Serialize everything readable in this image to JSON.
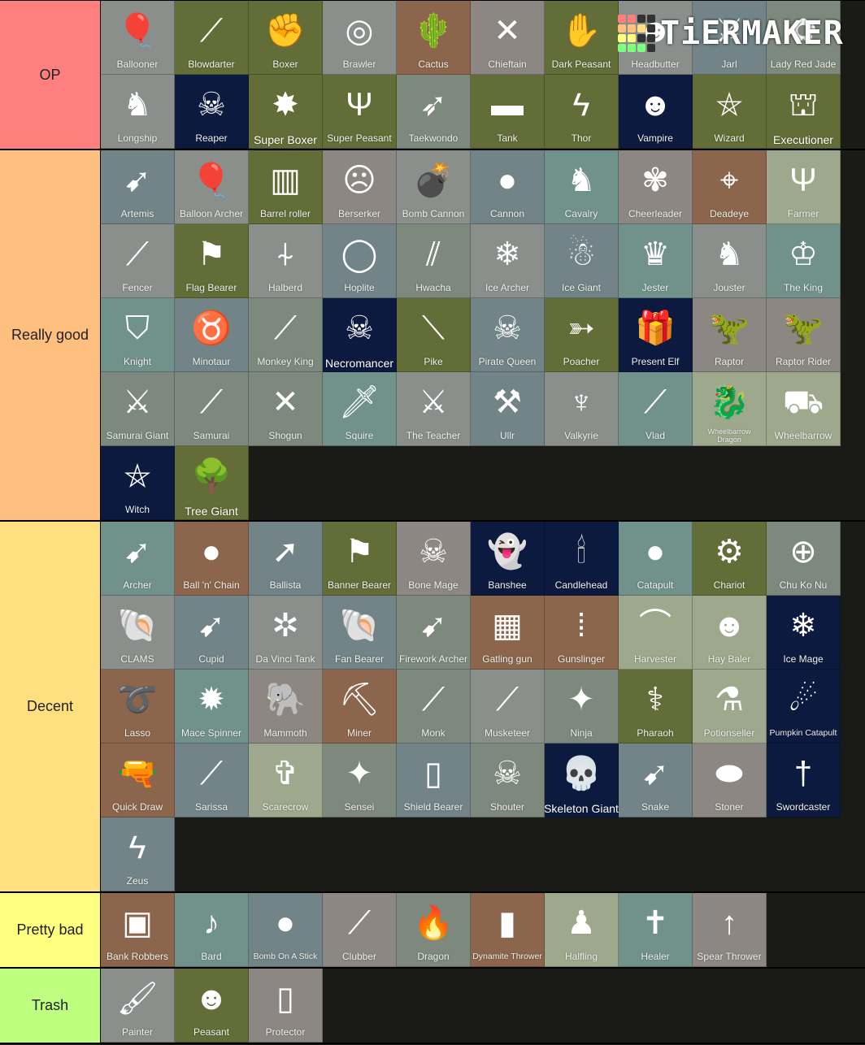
{
  "watermark": {
    "text": "TiERMAKER",
    "grid_colors": [
      "#ff7f7f",
      "#ff7f7f",
      "#333333",
      "#333333",
      "#ffbf7f",
      "#ffbf7f",
      "#ffdf7f",
      "#333333",
      "#ffff7f",
      "#ffff7f",
      "#333333",
      "#333333",
      "#7fff7f",
      "#7fff7f",
      "#7fff7f",
      "#333333"
    ]
  },
  "tiers": [
    {
      "label": "OP",
      "color": "#ff7f7f",
      "items": [
        {
          "name": "Ballooner",
          "bg": "gray",
          "icon": "balloons-icon",
          "glyph": "🎈"
        },
        {
          "name": "Blowdarter",
          "bg": "olive",
          "icon": "blowdart-icon",
          "glyph": "⟋"
        },
        {
          "name": "Boxer",
          "bg": "olive",
          "icon": "boxing-gloves-icon",
          "glyph": "✊"
        },
        {
          "name": "Brawler",
          "bg": "gray",
          "icon": "ring-icon",
          "glyph": "◎"
        },
        {
          "name": "Cactus",
          "bg": "brown",
          "icon": "cactus-icon",
          "glyph": "🌵"
        },
        {
          "name": "Chieftain",
          "bg": "taupe",
          "icon": "crossed-axes-icon",
          "glyph": "✕"
        },
        {
          "name": "Dark Peasant",
          "bg": "olive",
          "icon": "hands-icon",
          "glyph": "✋"
        },
        {
          "name": "Headbutter",
          "bg": "gray",
          "icon": "headbutter-icon",
          "glyph": "☻"
        },
        {
          "name": "Jarl",
          "bg": "slate",
          "icon": "jarl-icon",
          "glyph": "⚔"
        },
        {
          "name": "Lady Red Jade",
          "bg": "greengray",
          "icon": "lady-red-jade-icon",
          "glyph": "✿"
        },
        {
          "name": "Longship",
          "bg": "gray",
          "icon": "dragon-head-icon",
          "glyph": "♞"
        },
        {
          "name": "Reaper",
          "bg": "navy",
          "icon": "reaper-skull-icon",
          "glyph": "☠"
        },
        {
          "name": "Super Boxer",
          "bg": "olive",
          "icon": "super-boxer-icon",
          "glyph": "✸",
          "big": true
        },
        {
          "name": "Super Peasant",
          "bg": "olive",
          "icon": "super-peasant-icon",
          "glyph": "Ψ"
        },
        {
          "name": "Taekwondo",
          "bg": "greengray",
          "icon": "kick-icon",
          "glyph": "➶"
        },
        {
          "name": "Tank",
          "bg": "olive",
          "icon": "tank-icon",
          "glyph": "▬"
        },
        {
          "name": "Thor",
          "bg": "olive",
          "icon": "hammer-lightning-icon",
          "glyph": "ϟ"
        },
        {
          "name": "Vampire",
          "bg": "navy",
          "icon": "vampire-mask-icon",
          "glyph": "☻"
        },
        {
          "name": "Wizard",
          "bg": "olive",
          "icon": "wizard-hat-icon",
          "glyph": "⛤"
        },
        {
          "name": "Executioner",
          "bg": "olive",
          "icon": "executioner-hood-icon",
          "glyph": "⛫",
          "big": true
        }
      ]
    },
    {
      "label": "Really good",
      "color": "#ffbf7f",
      "items": [
        {
          "name": "Artemis",
          "bg": "slate",
          "icon": "bow-arrow-icon",
          "glyph": "➹"
        },
        {
          "name": "Balloon Archer",
          "bg": "gray",
          "icon": "balloon-arrow-icon",
          "glyph": "🎈"
        },
        {
          "name": "Barrel roller",
          "bg": "olive",
          "icon": "barrel-icon",
          "glyph": "▥"
        },
        {
          "name": "Berserker",
          "bg": "taupe",
          "icon": "berserker-icon",
          "glyph": "☹"
        },
        {
          "name": "Bomb Cannon",
          "bg": "gray",
          "icon": "bomb-cannon-icon",
          "glyph": "💣"
        },
        {
          "name": "Cannon",
          "bg": "slate",
          "icon": "cannon-icon",
          "glyph": "●"
        },
        {
          "name": "Cavalry",
          "bg": "teal",
          "icon": "horse-lance-icon",
          "glyph": "♞"
        },
        {
          "name": "Cheerleader",
          "bg": "taupe",
          "icon": "pompoms-icon",
          "glyph": "✾"
        },
        {
          "name": "Deadeye",
          "bg": "brown",
          "icon": "crosshair-icon",
          "glyph": "⌖"
        },
        {
          "name": "Farmer",
          "bg": "sage",
          "icon": "pitchfork-icon",
          "glyph": "Ψ"
        },
        {
          "name": "Fencer",
          "bg": "gray",
          "icon": "rapier-icon",
          "glyph": "⟋"
        },
        {
          "name": "Flag Bearer",
          "bg": "olive",
          "icon": "flag-icon",
          "glyph": "⚑"
        },
        {
          "name": "Halberd",
          "bg": "gray",
          "icon": "halberd-icon",
          "glyph": "⍭"
        },
        {
          "name": "Hoplite",
          "bg": "slate",
          "icon": "shield-spear-icon",
          "glyph": "◯"
        },
        {
          "name": "Hwacha",
          "bg": "greengray",
          "icon": "arrows-icon",
          "glyph": "⫽"
        },
        {
          "name": "Ice Archer",
          "bg": "gray",
          "icon": "ice-bow-icon",
          "glyph": "❄"
        },
        {
          "name": "Ice Giant",
          "bg": "slate",
          "icon": "ice-giant-icon",
          "glyph": "☃"
        },
        {
          "name": "Jester",
          "bg": "teal",
          "icon": "jester-hat-icon",
          "glyph": "♛"
        },
        {
          "name": "Jouster",
          "bg": "gray",
          "icon": "horse-head-icon",
          "glyph": "♞"
        },
        {
          "name": "The King",
          "bg": "teal",
          "icon": "crown-icon",
          "glyph": "♔"
        },
        {
          "name": "Knight",
          "bg": "teal",
          "icon": "shield-icon",
          "glyph": "⛉"
        },
        {
          "name": "Minotaur",
          "bg": "slate",
          "icon": "bull-head-icon",
          "glyph": "♉"
        },
        {
          "name": "Monkey King",
          "bg": "greengray",
          "icon": "staff-tail-icon",
          "glyph": "⟋"
        },
        {
          "name": "Necromancer",
          "bg": "navy",
          "icon": "necromancer-icon",
          "glyph": "☠",
          "big": true
        },
        {
          "name": "Pike",
          "bg": "olive",
          "icon": "pike-icon",
          "glyph": "⟍"
        },
        {
          "name": "Pirate Queen",
          "bg": "slate",
          "icon": "pirate-icon",
          "glyph": "☠"
        },
        {
          "name": "Poacher",
          "bg": "olive",
          "icon": "bow-icon",
          "glyph": "➳"
        },
        {
          "name": "Present Elf",
          "bg": "navy",
          "icon": "present-icon",
          "glyph": "🎁"
        },
        {
          "name": "Raptor",
          "bg": "taupe",
          "icon": "raptor-icon",
          "glyph": "🦖"
        },
        {
          "name": "Raptor Rider",
          "bg": "taupe",
          "icon": "raptor-rider-icon",
          "glyph": "🦖"
        },
        {
          "name": "Samurai Giant",
          "bg": "greengray",
          "icon": "samurai-giant-icon",
          "glyph": "⚔"
        },
        {
          "name": "Samurai",
          "bg": "greengray",
          "icon": "katana-icon",
          "glyph": "⟋"
        },
        {
          "name": "Shogun",
          "bg": "greengray",
          "icon": "shogun-icon",
          "glyph": "✕"
        },
        {
          "name": "Squire",
          "bg": "teal",
          "icon": "sword-icon",
          "glyph": "🗡"
        },
        {
          "name": "The Teacher",
          "bg": "gray",
          "icon": "greatsword-icon",
          "glyph": "⚔"
        },
        {
          "name": "Ullr",
          "bg": "slate",
          "icon": "double-axe-icon",
          "glyph": "⚒"
        },
        {
          "name": "Valkyrie",
          "bg": "gray",
          "icon": "winged-helm-icon",
          "glyph": "♆"
        },
        {
          "name": "Vlad",
          "bg": "teal",
          "icon": "stake-icon",
          "glyph": "⟋"
        },
        {
          "name": "Wheelbarrow Dragon",
          "bg": "sage",
          "icon": "wheelbarrow-dragon-icon",
          "glyph": "🐉",
          "tiny": true
        },
        {
          "name": "Wheelbarrow",
          "bg": "sage",
          "icon": "wheelbarrow-icon",
          "glyph": "⛟"
        },
        {
          "name": "Witch",
          "bg": "navy",
          "icon": "witch-hat-icon",
          "glyph": "⛤"
        },
        {
          "name": "Tree Giant",
          "bg": "olive",
          "icon": "tree-icon",
          "glyph": "🌳",
          "big": true
        }
      ]
    },
    {
      "label": "Decent",
      "color": "#ffdf7f",
      "items": [
        {
          "name": "Archer",
          "bg": "teal",
          "icon": "bow-arrow-icon",
          "glyph": "➹"
        },
        {
          "name": "Ball 'n' Chain",
          "bg": "brown",
          "icon": "ball-chain-icon",
          "glyph": "●"
        },
        {
          "name": "Ballista",
          "bg": "slate",
          "icon": "ballista-icon",
          "glyph": "➚"
        },
        {
          "name": "Banner Bearer",
          "bg": "olive",
          "icon": "banners-icon",
          "glyph": "⚑"
        },
        {
          "name": "Bone Mage",
          "bg": "taupe",
          "icon": "deer-skull-icon",
          "glyph": "☠"
        },
        {
          "name": "Banshee",
          "bg": "navy",
          "icon": "banshee-icon",
          "glyph": "👻"
        },
        {
          "name": "Candlehead",
          "bg": "navy",
          "icon": "candlehead-icon",
          "glyph": "🕯"
        },
        {
          "name": "Catapult",
          "bg": "teal",
          "icon": "catapult-icon",
          "glyph": "●"
        },
        {
          "name": "Chariot",
          "bg": "olive",
          "icon": "chariot-icon",
          "glyph": "⚙"
        },
        {
          "name": "Chu Ko Nu",
          "bg": "greengray",
          "icon": "crossbow-icon",
          "glyph": "⊕"
        },
        {
          "name": "CLAMS",
          "bg": "gray",
          "icon": "clam-shell-icon",
          "glyph": "🐚"
        },
        {
          "name": "Cupid",
          "bg": "slate",
          "icon": "cupid-bow-icon",
          "glyph": "➹"
        },
        {
          "name": "Da Vinci Tank",
          "bg": "gray",
          "icon": "da-vinci-tank-icon",
          "glyph": "✲"
        },
        {
          "name": "Fan Bearer",
          "bg": "slate",
          "icon": "fan-icon",
          "glyph": "🐚"
        },
        {
          "name": "Firework Archer",
          "bg": "greengray",
          "icon": "firework-bow-icon",
          "glyph": "➹"
        },
        {
          "name": "Gatling gun",
          "bg": "brown",
          "icon": "gatling-icon",
          "glyph": "▦"
        },
        {
          "name": "Gunslinger",
          "bg": "brown",
          "icon": "bullets-icon",
          "glyph": "⁞"
        },
        {
          "name": "Harvester",
          "bg": "sage",
          "icon": "scythe-icon",
          "glyph": "⌒"
        },
        {
          "name": "Hay Baler",
          "bg": "sage",
          "icon": "hay-baler-icon",
          "glyph": "☻"
        },
        {
          "name": "Ice Mage",
          "bg": "navy",
          "icon": "ice-wand-icon",
          "glyph": "❄"
        },
        {
          "name": "Lasso",
          "bg": "brown",
          "icon": "lasso-icon",
          "glyph": "➰"
        },
        {
          "name": "Mace Spinner",
          "bg": "teal",
          "icon": "maces-icon",
          "glyph": "✹"
        },
        {
          "name": "Mammoth",
          "bg": "taupe",
          "icon": "mammoth-icon",
          "glyph": "🐘"
        },
        {
          "name": "Miner",
          "bg": "brown",
          "icon": "pickaxe-icon",
          "glyph": "⛏"
        },
        {
          "name": "Monk",
          "bg": "greengray",
          "icon": "staff-icon",
          "glyph": "⟋"
        },
        {
          "name": "Musketeer",
          "bg": "gray",
          "icon": "musket-icon",
          "glyph": "⟋"
        },
        {
          "name": "Ninja",
          "bg": "greengray",
          "icon": "shuriken-icon",
          "glyph": "✦"
        },
        {
          "name": "Pharaoh",
          "bg": "olive",
          "icon": "crook-flail-icon",
          "glyph": "⚕"
        },
        {
          "name": "Potionseller",
          "bg": "sage",
          "icon": "potion-flask-icon",
          "glyph": "⚗"
        },
        {
          "name": "Pumpkin Catapult",
          "bg": "navy",
          "icon": "pumpkin-icon",
          "glyph": "☄",
          "small": true
        },
        {
          "name": "Quick Draw",
          "bg": "brown",
          "icon": "revolver-icon",
          "glyph": "🔫"
        },
        {
          "name": "Sarissa",
          "bg": "slate",
          "icon": "long-spear-icon",
          "glyph": "⟋"
        },
        {
          "name": "Scarecrow",
          "bg": "sage",
          "icon": "scarecrow-icon",
          "glyph": "✞"
        },
        {
          "name": "Sensei",
          "bg": "greengray",
          "icon": "throwing-stars-icon",
          "glyph": "✦"
        },
        {
          "name": "Shield Bearer",
          "bg": "slate",
          "icon": "tower-shield-icon",
          "glyph": "▯"
        },
        {
          "name": "Shouter",
          "bg": "greengray",
          "icon": "horned-skull-icon",
          "glyph": "☠"
        },
        {
          "name": "Skeleton Giant",
          "bg": "navy",
          "icon": "giant-skull-icon",
          "glyph": "💀",
          "big": true
        },
        {
          "name": "Snake",
          "bg": "slate",
          "icon": "snake-bow-icon",
          "glyph": "➹"
        },
        {
          "name": "Stoner",
          "bg": "taupe",
          "icon": "boulder-icon",
          "glyph": "⬬"
        },
        {
          "name": "Swordcaster",
          "bg": "navy",
          "icon": "swordcaster-icon",
          "glyph": "†"
        },
        {
          "name": "Zeus",
          "bg": "slate",
          "icon": "lightning-icon",
          "glyph": "ϟ"
        }
      ]
    },
    {
      "label": "Pretty bad",
      "color": "#ffff7f",
      "items": [
        {
          "name": "Bank Robbers",
          "bg": "brown",
          "icon": "safe-icon",
          "glyph": "▣"
        },
        {
          "name": "Bard",
          "bg": "teal",
          "icon": "banjo-icon",
          "glyph": "♪"
        },
        {
          "name": "Bomb On A Stick",
          "bg": "slate",
          "icon": "bomb-stick-icon",
          "glyph": "●",
          "small": true
        },
        {
          "name": "Clubber",
          "bg": "taupe",
          "icon": "club-icon",
          "glyph": "⟋"
        },
        {
          "name": "Dragon",
          "bg": "greengray",
          "icon": "flame-icon",
          "glyph": "🔥"
        },
        {
          "name": "Dynamite Thrower",
          "bg": "brown",
          "icon": "dynamite-icon",
          "glyph": "▮",
          "small": true
        },
        {
          "name": "Halfling",
          "bg": "sage",
          "icon": "halfling-hat-icon",
          "glyph": "♟"
        },
        {
          "name": "Healer",
          "bg": "teal",
          "icon": "mitre-icon",
          "glyph": "✝"
        },
        {
          "name": "Spear Thrower",
          "bg": "taupe",
          "icon": "spear-icon",
          "glyph": "↑"
        }
      ]
    },
    {
      "label": "Trash",
      "color": "#bfff7f",
      "items": [
        {
          "name": "Painter",
          "bg": "gray",
          "icon": "paintbrush-icon",
          "glyph": "🖌"
        },
        {
          "name": "Peasant",
          "bg": "olive",
          "icon": "peasant-hood-icon",
          "glyph": "☻"
        },
        {
          "name": "Protector",
          "bg": "taupe",
          "icon": "protector-icon",
          "glyph": "▯"
        }
      ]
    }
  ]
}
